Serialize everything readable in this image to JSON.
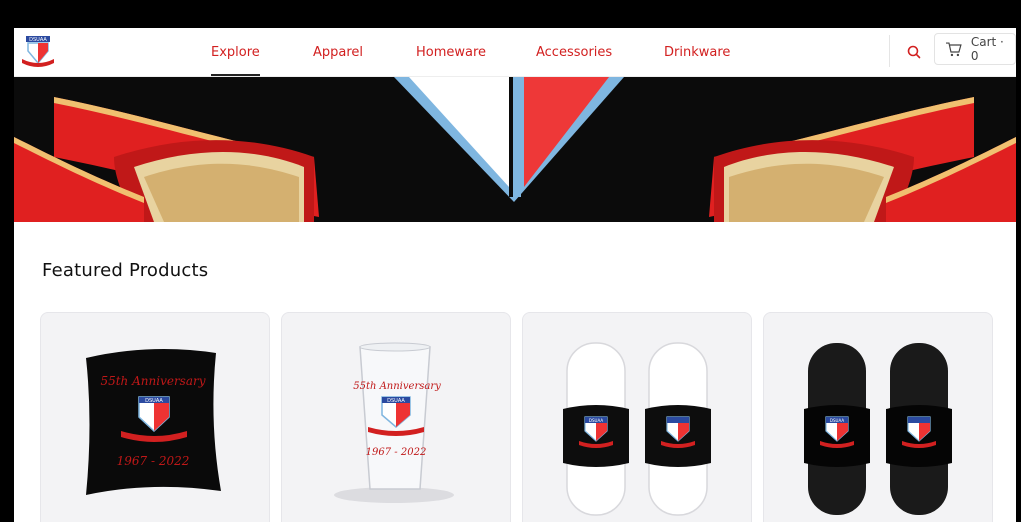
{
  "nav": {
    "items": [
      {
        "label": "Explore",
        "active": true
      },
      {
        "label": "Apparel",
        "active": false
      },
      {
        "label": "Homeware",
        "active": false
      },
      {
        "label": "Accessories",
        "active": false
      },
      {
        "label": "Drinkware",
        "active": false
      }
    ]
  },
  "logo": {
    "text": "DSUAA"
  },
  "search": {
    "icon": "search-icon"
  },
  "cart": {
    "label": "Cart · 0",
    "icon": "cart-icon"
  },
  "featured": {
    "title": "Featured Products",
    "products": [
      {
        "type": "pillow",
        "text_top": "55th Anniversary",
        "text_bottom": "1967 - 2022",
        "badge": "DSUAA"
      },
      {
        "type": "pint-glass",
        "text_top": "55th Anniversary",
        "text_bottom": "1967 - 2022",
        "badge": "DSUAA"
      },
      {
        "type": "slides-white",
        "badge": "DSUAA"
      },
      {
        "type": "slides-black",
        "badge": "DSUAA"
      }
    ]
  },
  "colors": {
    "accent": "#d22020",
    "banner_bg": "#0b0b0b",
    "ribbon_red": "#e02020",
    "ribbon_gold": "#e8d3a0",
    "shield_blue": "#7fb6e0"
  }
}
